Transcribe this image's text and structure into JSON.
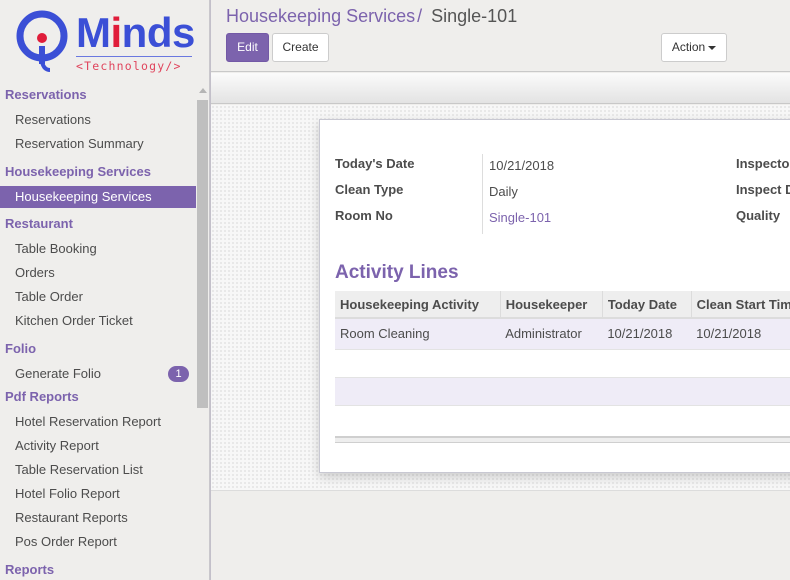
{
  "logo": {
    "brand": "Minds",
    "tagline": "<Technology/>",
    "colors": {
      "primary": "#3b4fd6",
      "accent": "#e01d3a"
    }
  },
  "sidebar": {
    "sections": [
      {
        "title": "Reservations",
        "items": [
          {
            "label": "Reservations"
          },
          {
            "label": "Reservation Summary"
          }
        ]
      },
      {
        "title": "Housekeeping Services",
        "items": [
          {
            "label": "Housekeeping Services",
            "active": true
          }
        ]
      },
      {
        "title": "Restaurant",
        "items": [
          {
            "label": "Table Booking"
          },
          {
            "label": "Orders"
          },
          {
            "label": "Table Order"
          },
          {
            "label": "Kitchen Order Ticket"
          }
        ]
      },
      {
        "title": "Folio",
        "items": [
          {
            "label": "Generate Folio",
            "badge": "1"
          }
        ]
      },
      {
        "title": "Pdf Reports",
        "items": [
          {
            "label": "Hotel Reservation Report"
          },
          {
            "label": "Activity Report"
          },
          {
            "label": "Table Reservation List"
          },
          {
            "label": "Hotel Folio Report"
          },
          {
            "label": "Restaurant Reports"
          },
          {
            "label": "Pos Order Report"
          }
        ]
      },
      {
        "title": "Reports",
        "items": []
      }
    ]
  },
  "breadcrumb": {
    "parent": "Housekeeping Services",
    "separator": "/",
    "current": "Single-101"
  },
  "toolbar": {
    "edit_label": "Edit",
    "create_label": "Create",
    "action_label": "Action"
  },
  "form": {
    "fields_left": [
      {
        "label": "Today's Date",
        "value": "10/21/2018"
      },
      {
        "label": "Clean Type",
        "value": "Daily"
      },
      {
        "label": "Room No",
        "value": "Single-101"
      }
    ],
    "fields_right": [
      {
        "label": "Inspector"
      },
      {
        "label": "Inspect Date"
      },
      {
        "label": "Quality"
      }
    ]
  },
  "activity_lines": {
    "title": "Activity Lines",
    "columns": [
      "Housekeeping Activity",
      "Housekeeper",
      "Today Date",
      "Clean Start Time"
    ],
    "rows": [
      [
        "Room Cleaning",
        "Administrator",
        "10/21/2018",
        "10/21/2018"
      ]
    ]
  },
  "theme": {
    "accent": "#7c63ad"
  }
}
